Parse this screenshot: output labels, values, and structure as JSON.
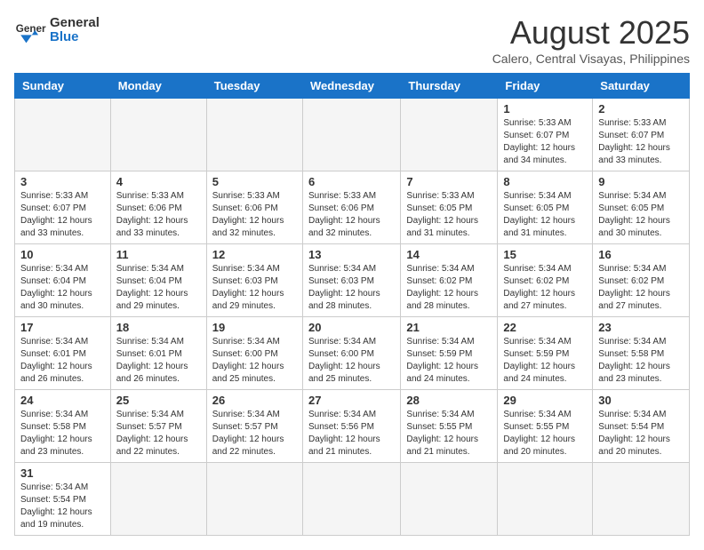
{
  "header": {
    "logo_general": "General",
    "logo_blue": "Blue",
    "month_title": "August 2025",
    "location": "Calero, Central Visayas, Philippines"
  },
  "weekdays": [
    "Sunday",
    "Monday",
    "Tuesday",
    "Wednesday",
    "Thursday",
    "Friday",
    "Saturday"
  ],
  "weeks": [
    [
      {
        "day": "",
        "info": ""
      },
      {
        "day": "",
        "info": ""
      },
      {
        "day": "",
        "info": ""
      },
      {
        "day": "",
        "info": ""
      },
      {
        "day": "",
        "info": ""
      },
      {
        "day": "1",
        "info": "Sunrise: 5:33 AM\nSunset: 6:07 PM\nDaylight: 12 hours and 34 minutes."
      },
      {
        "day": "2",
        "info": "Sunrise: 5:33 AM\nSunset: 6:07 PM\nDaylight: 12 hours and 33 minutes."
      }
    ],
    [
      {
        "day": "3",
        "info": "Sunrise: 5:33 AM\nSunset: 6:07 PM\nDaylight: 12 hours and 33 minutes."
      },
      {
        "day": "4",
        "info": "Sunrise: 5:33 AM\nSunset: 6:06 PM\nDaylight: 12 hours and 33 minutes."
      },
      {
        "day": "5",
        "info": "Sunrise: 5:33 AM\nSunset: 6:06 PM\nDaylight: 12 hours and 32 minutes."
      },
      {
        "day": "6",
        "info": "Sunrise: 5:33 AM\nSunset: 6:06 PM\nDaylight: 12 hours and 32 minutes."
      },
      {
        "day": "7",
        "info": "Sunrise: 5:33 AM\nSunset: 6:05 PM\nDaylight: 12 hours and 31 minutes."
      },
      {
        "day": "8",
        "info": "Sunrise: 5:34 AM\nSunset: 6:05 PM\nDaylight: 12 hours and 31 minutes."
      },
      {
        "day": "9",
        "info": "Sunrise: 5:34 AM\nSunset: 6:05 PM\nDaylight: 12 hours and 30 minutes."
      }
    ],
    [
      {
        "day": "10",
        "info": "Sunrise: 5:34 AM\nSunset: 6:04 PM\nDaylight: 12 hours and 30 minutes."
      },
      {
        "day": "11",
        "info": "Sunrise: 5:34 AM\nSunset: 6:04 PM\nDaylight: 12 hours and 29 minutes."
      },
      {
        "day": "12",
        "info": "Sunrise: 5:34 AM\nSunset: 6:03 PM\nDaylight: 12 hours and 29 minutes."
      },
      {
        "day": "13",
        "info": "Sunrise: 5:34 AM\nSunset: 6:03 PM\nDaylight: 12 hours and 28 minutes."
      },
      {
        "day": "14",
        "info": "Sunrise: 5:34 AM\nSunset: 6:02 PM\nDaylight: 12 hours and 28 minutes."
      },
      {
        "day": "15",
        "info": "Sunrise: 5:34 AM\nSunset: 6:02 PM\nDaylight: 12 hours and 27 minutes."
      },
      {
        "day": "16",
        "info": "Sunrise: 5:34 AM\nSunset: 6:02 PM\nDaylight: 12 hours and 27 minutes."
      }
    ],
    [
      {
        "day": "17",
        "info": "Sunrise: 5:34 AM\nSunset: 6:01 PM\nDaylight: 12 hours and 26 minutes."
      },
      {
        "day": "18",
        "info": "Sunrise: 5:34 AM\nSunset: 6:01 PM\nDaylight: 12 hours and 26 minutes."
      },
      {
        "day": "19",
        "info": "Sunrise: 5:34 AM\nSunset: 6:00 PM\nDaylight: 12 hours and 25 minutes."
      },
      {
        "day": "20",
        "info": "Sunrise: 5:34 AM\nSunset: 6:00 PM\nDaylight: 12 hours and 25 minutes."
      },
      {
        "day": "21",
        "info": "Sunrise: 5:34 AM\nSunset: 5:59 PM\nDaylight: 12 hours and 24 minutes."
      },
      {
        "day": "22",
        "info": "Sunrise: 5:34 AM\nSunset: 5:59 PM\nDaylight: 12 hours and 24 minutes."
      },
      {
        "day": "23",
        "info": "Sunrise: 5:34 AM\nSunset: 5:58 PM\nDaylight: 12 hours and 23 minutes."
      }
    ],
    [
      {
        "day": "24",
        "info": "Sunrise: 5:34 AM\nSunset: 5:58 PM\nDaylight: 12 hours and 23 minutes."
      },
      {
        "day": "25",
        "info": "Sunrise: 5:34 AM\nSunset: 5:57 PM\nDaylight: 12 hours and 22 minutes."
      },
      {
        "day": "26",
        "info": "Sunrise: 5:34 AM\nSunset: 5:57 PM\nDaylight: 12 hours and 22 minutes."
      },
      {
        "day": "27",
        "info": "Sunrise: 5:34 AM\nSunset: 5:56 PM\nDaylight: 12 hours and 21 minutes."
      },
      {
        "day": "28",
        "info": "Sunrise: 5:34 AM\nSunset: 5:55 PM\nDaylight: 12 hours and 21 minutes."
      },
      {
        "day": "29",
        "info": "Sunrise: 5:34 AM\nSunset: 5:55 PM\nDaylight: 12 hours and 20 minutes."
      },
      {
        "day": "30",
        "info": "Sunrise: 5:34 AM\nSunset: 5:54 PM\nDaylight: 12 hours and 20 minutes."
      }
    ],
    [
      {
        "day": "31",
        "info": "Sunrise: 5:34 AM\nSunset: 5:54 PM\nDaylight: 12 hours and 19 minutes."
      },
      {
        "day": "",
        "info": ""
      },
      {
        "day": "",
        "info": ""
      },
      {
        "day": "",
        "info": ""
      },
      {
        "day": "",
        "info": ""
      },
      {
        "day": "",
        "info": ""
      },
      {
        "day": "",
        "info": ""
      }
    ]
  ]
}
